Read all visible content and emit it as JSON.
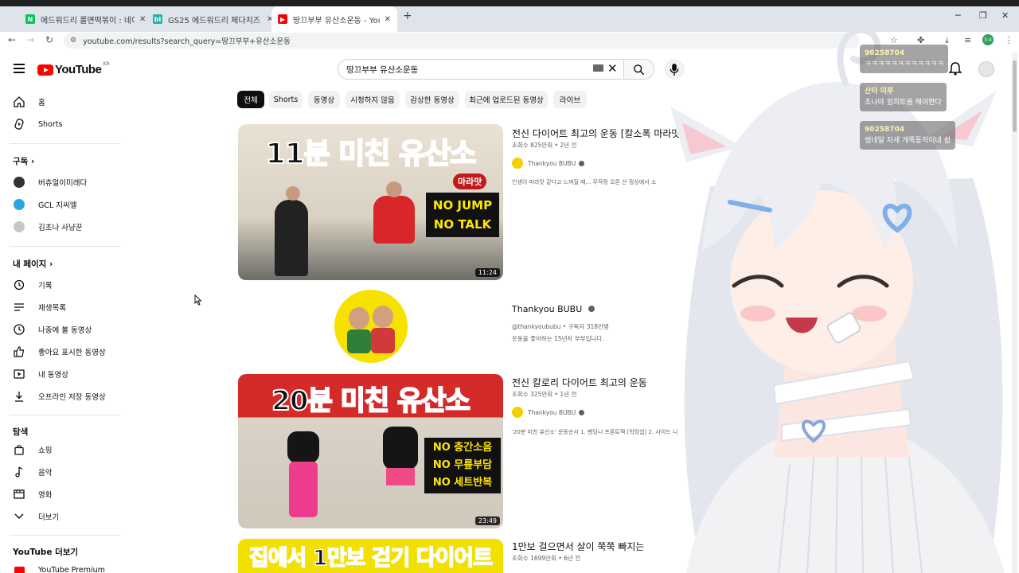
{
  "browser": {
    "tabs": [
      {
        "title": "에드워드리 롤면떡볶이 : 네이버",
        "favicon_letter": "N",
        "favicon_color": "#03c75a"
      },
      {
        "title": "GS25 에드워드리 체다치즈 롤",
        "favicon_letter": "bl",
        "favicon_color": "#1fb5ad"
      },
      {
        "title": "땅끄부부 유산소운동 - YouTube",
        "favicon_letter": "",
        "favicon_color": "#ff0000"
      }
    ],
    "url": "youtube.com/results?search_query=땅끄부부+유산소운동",
    "profile_badge": "3:4"
  },
  "header": {
    "logo_word": "YouTube",
    "logo_region": "KR",
    "search_value": "땅끄부부 유산소운동"
  },
  "sidebar": {
    "main": [
      {
        "label": "홈",
        "icon": "home-icon"
      },
      {
        "label": "Shorts",
        "icon": "shorts-icon"
      }
    ],
    "subscriptions_heading": "구독",
    "subscriptions": [
      {
        "label": "버츄얼이미래다",
        "color": "#333333"
      },
      {
        "label": "GCL 지씨엘",
        "color": "#2aa7e0"
      },
      {
        "label": "김초나 사냥꾼",
        "color": "#c8c8c8"
      }
    ],
    "you_heading": "내 페이지",
    "you": [
      {
        "label": "기록",
        "icon": "history-icon"
      },
      {
        "label": "재생목록",
        "icon": "playlist-icon"
      },
      {
        "label": "나중에 볼 동영상",
        "icon": "clock-icon"
      },
      {
        "label": "좋아요 표시한 동영상",
        "icon": "thumb-up-icon"
      },
      {
        "label": "내 동영상",
        "icon": "video-icon"
      },
      {
        "label": "오프라인 저장 동영상",
        "icon": "download-icon"
      }
    ],
    "explore_heading": "탐색",
    "explore": [
      {
        "label": "쇼핑",
        "icon": "shopping-bag-icon"
      },
      {
        "label": "음악",
        "icon": "music-note-icon"
      },
      {
        "label": "영화",
        "icon": "film-icon"
      },
      {
        "label": "더보기",
        "icon": "chevron-down-icon"
      }
    ],
    "more_heading": "YouTube 더보기",
    "more": [
      {
        "label": "YouTube Premium",
        "icon": "youtube-premium-icon"
      }
    ]
  },
  "chips": [
    "전체",
    "Shorts",
    "동영상",
    "시청하지 않음",
    "감상한 동영상",
    "최근에 업로드된 동영상",
    "라이브"
  ],
  "results": [
    {
      "thumb_text": "11분 미친 유산소",
      "badge_text": "마라맛",
      "overlay_lines": [
        "NO JUMP",
        "NO TALK"
      ],
      "duration": "11:24",
      "title": "전신 다이어트 최고의 운동 [칼소폭 마라맛",
      "meta": "조회수 825만회 • 2년 전",
      "channel": "Thankyou BUBU",
      "desc": "인생이 마라맛 같다고 느껴질 때... 무작정 오른 산 정상에서 소"
    },
    {
      "title": "전신 칼로리 다이어트 최고의 운동",
      "meta": "조회수 325만회 • 1년 전",
      "channel": "Thankyou BUBU",
      "thumb_text": "20분 미친 유산소",
      "overlay_lines": [
        "NO 층간소음",
        "NO 무릎부담",
        "NO 세트반복"
      ],
      "duration": "23:49",
      "desc": "'20분 미친 유산소' 운동순서 1. 밴딩니 프론트잭 [워밍업] 2. 사이드 니"
    },
    {
      "thumb_text": "집에서 1만보 걷기 다이어트",
      "title": "1만보 걸으면서 살이 쭉쭉 빠지는",
      "meta": "조회수 1699만회 • 6년 전"
    }
  ],
  "channel_result": {
    "name": "Thankyou BUBU",
    "meta": "@thankyoububu • 구독자 318만명",
    "desc": "운동을 좋아하는 15년차 부부입니다."
  },
  "chat": [
    {
      "name": "90258704",
      "text": "ㅋㅋㅋㅋㅋㅋㅋㅋㅋㅋㅋㅋ"
    },
    {
      "name": "산타 미루",
      "text": "초나야 힘피트를 해야한다"
    },
    {
      "name": "90258704",
      "text": "썸네일 자세 개똑동작이네 쉽"
    }
  ]
}
